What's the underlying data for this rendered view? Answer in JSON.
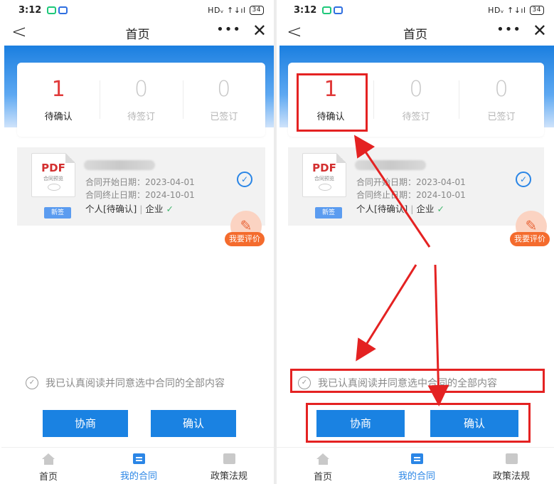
{
  "status_bar": {
    "time": "3:12",
    "right": "HDᵥ ↑↓ıl",
    "battery": "34"
  },
  "nav": {
    "back": "<",
    "title": "首页",
    "more": "•••",
    "close": "✕"
  },
  "stats": [
    {
      "count": "1",
      "label": "待确认"
    },
    {
      "count": "0",
      "label": "待签订"
    },
    {
      "count": "0",
      "label": "已签订"
    }
  ],
  "contract": {
    "pdf_label": "PDF",
    "pdf_sub": "合同预览",
    "tag": "新签",
    "start": "合同开始日期：2023-04-01",
    "end": "合同终止日期：2024-10-01",
    "party_personal": "个人[待确认]",
    "party_enterprise": "企业"
  },
  "evaluate": {
    "label": "我要评价"
  },
  "agreement": {
    "text": "我已认真阅读并同意选中合同的全部内容"
  },
  "buttons": {
    "negotiate": "协商",
    "confirm": "确认"
  },
  "tabs": [
    {
      "label": "首页"
    },
    {
      "label": "我的合同"
    },
    {
      "label": "政策法规"
    }
  ],
  "colors": {
    "primary": "#1a82e2",
    "annotation": "#e42222",
    "pending_count": "#e03a3a",
    "evaluate": "#f46b2d"
  }
}
